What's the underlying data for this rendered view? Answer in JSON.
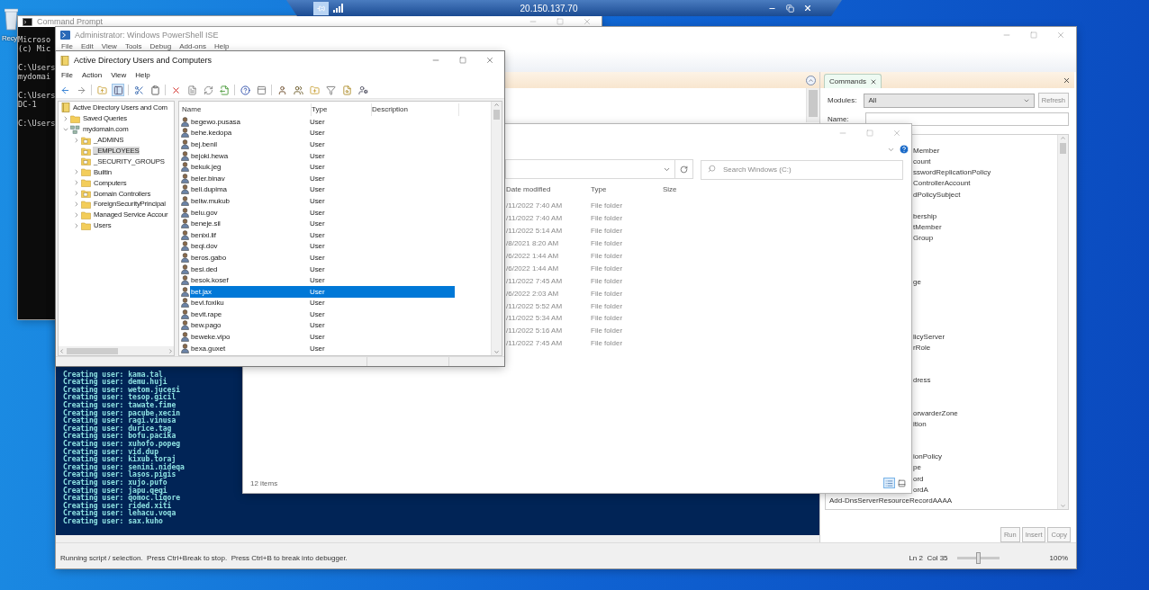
{
  "desktop": {
    "icon_label": "Recy"
  },
  "remote_bar": {
    "title": "20.150.137.70"
  },
  "command_prompt": {
    "title": "Command Prompt",
    "blocks": [
      [
        "Microso",
        "(c) Mic"
      ],
      [
        "C:\\Users",
        "mydomai"
      ],
      [
        "C:\\Users",
        "DC-1"
      ],
      [
        "C:\\Users"
      ]
    ]
  },
  "powershell_ise": {
    "title": "Administrator: Windows PowerShell ISE",
    "menu": [
      "File",
      "Edit",
      "View",
      "Tools",
      "Debug",
      "Add-ons",
      "Help"
    ],
    "console_lines": [
      "Creating user: kama.tal",
      "Creating user: demu.huji",
      "Creating user: wetom.jucesi",
      "Creating user: tesop.gicil",
      "Creating user: tawate.fime",
      "Creating user: pacube.xecin",
      "Creating user: ragi.vinusa",
      "Creating user: durice.tag",
      "Creating user: bofu.pacika",
      "Creating user: xuhofo.popeg",
      "Creating user: vid.dup",
      "Creating user: kixub.toraj",
      "Creating user: senini.nideqa",
      "Creating user: lasos.pigis",
      "Creating user: xujo.pufo",
      "Creating user: japu.qeqi",
      "Creating user: qomoc.liqore",
      "Creating user: rided.xiti",
      "Creating user: lehacu.voqa",
      "Creating user: sax.kuho"
    ],
    "commands": {
      "tab": "Commands",
      "modules_label": "Modules:",
      "modules_value": "All",
      "refresh": "Refresh",
      "name_label": "Name:",
      "items": [
        {
          "text": "Member",
          "kind": "clipped"
        },
        {
          "text": "count",
          "kind": "clipped"
        },
        {
          "text": "sswordReplicationPolicy",
          "kind": "clipped"
        },
        {
          "text": "ControllerAccount",
          "kind": "clipped"
        },
        {
          "text": "dPolicySubject",
          "kind": "clipped"
        },
        {
          "text": "bership",
          "kind": "clipped"
        },
        {
          "text": "tMember",
          "kind": "clipped"
        },
        {
          "text": "Group",
          "kind": "clipped"
        },
        {
          "text": "ge",
          "kind": "clipped"
        },
        {
          "text": "licyServer",
          "kind": "clipped"
        },
        {
          "text": "rRole",
          "kind": "clipped"
        },
        {
          "text": "dress",
          "kind": "clipped"
        },
        {
          "text": "orwarderZone",
          "kind": "clipped"
        },
        {
          "text": "ition",
          "kind": "clipped"
        },
        {
          "text": "ionPolicy",
          "kind": "clipped"
        },
        {
          "text": "pe",
          "kind": "clipped"
        },
        {
          "text": "ord",
          "kind": "clipped"
        },
        {
          "text": "ordA",
          "kind": "clipped"
        },
        {
          "text": "Add-DnsServerResourceRecordAAAA",
          "kind": "full"
        }
      ],
      "buttons": [
        "Run",
        "Insert",
        "Copy"
      ]
    },
    "status": "Running script / selection.  Press Ctrl+Break to stop.  Press Ctrl+B to break into debugger.",
    "position": "Ln 2  Col 35",
    "zoom": {
      "level": 0.5,
      "reading": "100%"
    }
  },
  "file_explorer": {
    "search_placeholder": "Search Windows (C:)",
    "columns": [
      "Date modified",
      "Type",
      "Size"
    ],
    "rows": [
      {
        "date": "/11/2022 7:40 AM",
        "type": "File folder"
      },
      {
        "date": "/11/2022 7:40 AM",
        "type": "File folder"
      },
      {
        "date": "/11/2022 5:14 AM",
        "type": "File folder"
      },
      {
        "date": "/8/2021 8:20 AM",
        "type": "File folder"
      },
      {
        "date": "/6/2022 1:44 AM",
        "type": "File folder"
      },
      {
        "date": "/6/2022 1:44 AM",
        "type": "File folder"
      },
      {
        "date": "/11/2022 7:45 AM",
        "type": "File folder"
      },
      {
        "date": "/6/2022 2:03 AM",
        "type": "File folder"
      },
      {
        "date": "/11/2022 5:52 AM",
        "type": "File folder"
      },
      {
        "date": "/11/2022 5:34 AM",
        "type": "File folder"
      },
      {
        "date": "/11/2022 5:16 AM",
        "type": "File folder"
      },
      {
        "date": "/11/2022 7:45 AM",
        "type": "File folder"
      }
    ],
    "status": "12 items"
  },
  "aduc": {
    "title": "Active Directory Users and Computers",
    "menu": [
      "File",
      "Action",
      "View",
      "Help"
    ],
    "show_tree_pressed": true,
    "tree": [
      {
        "label": "Active Directory Users and Com",
        "kind": "root",
        "selected": false,
        "children": [
          {
            "label": "Saved Queries",
            "kind": "folder",
            "expanded": false,
            "selected": false
          },
          {
            "label": "mydomain.com",
            "kind": "domain",
            "expanded": true,
            "selected": false,
            "children": [
              {
                "label": "_ADMINS",
                "kind": "ou",
                "expanded": false,
                "selected": false
              },
              {
                "label": "_EMPLOYEES",
                "kind": "ou",
                "selected": true
              },
              {
                "label": "_SECURITY_GROUPS",
                "kind": "ou",
                "selected": false
              },
              {
                "label": "Builtin",
                "kind": "folder",
                "expanded": false,
                "selected": false
              },
              {
                "label": "Computers",
                "kind": "folder",
                "expanded": false,
                "selected": false
              },
              {
                "label": "Domain Controllers",
                "kind": "ou",
                "expanded": false,
                "selected": false
              },
              {
                "label": "ForeignSecurityPrincipal",
                "kind": "folder",
                "expanded": false,
                "selected": false
              },
              {
                "label": "Managed Service Accour",
                "kind": "folder",
                "expanded": false,
                "selected": false
              },
              {
                "label": "Users",
                "kind": "folder",
                "expanded": false,
                "selected": false
              }
            ]
          }
        ]
      }
    ],
    "columns": [
      "Name",
      "Type",
      "Description"
    ],
    "rows": [
      {
        "name": "begewo.pusasa",
        "type": "User",
        "selected": false
      },
      {
        "name": "behe.kedopa",
        "type": "User",
        "selected": false
      },
      {
        "name": "bej.benil",
        "type": "User",
        "selected": false
      },
      {
        "name": "bejoki.hewa",
        "type": "User",
        "selected": false
      },
      {
        "name": "bekuk.jeg",
        "type": "User",
        "selected": false
      },
      {
        "name": "beler.binav",
        "type": "User",
        "selected": false
      },
      {
        "name": "beli.dupima",
        "type": "User",
        "selected": false
      },
      {
        "name": "beliw.mukub",
        "type": "User",
        "selected": false
      },
      {
        "name": "belu.gov",
        "type": "User",
        "selected": false
      },
      {
        "name": "beneje.sil",
        "type": "User",
        "selected": false
      },
      {
        "name": "benixi.lif",
        "type": "User",
        "selected": false
      },
      {
        "name": "beqi.dov",
        "type": "User",
        "selected": false
      },
      {
        "name": "beros.gabo",
        "type": "User",
        "selected": false
      },
      {
        "name": "besi.ded",
        "type": "User",
        "selected": false
      },
      {
        "name": "besok.kosef",
        "type": "User",
        "selected": false
      },
      {
        "name": "bet.jax",
        "type": "User",
        "selected": true
      },
      {
        "name": "bevi.foxiku",
        "type": "User",
        "selected": false
      },
      {
        "name": "bevit.rape",
        "type": "User",
        "selected": false
      },
      {
        "name": "bew.pago",
        "type": "User",
        "selected": false
      },
      {
        "name": "beweke.vipo",
        "type": "User",
        "selected": false
      },
      {
        "name": "bexa.guxet",
        "type": "User",
        "selected": false
      }
    ]
  }
}
